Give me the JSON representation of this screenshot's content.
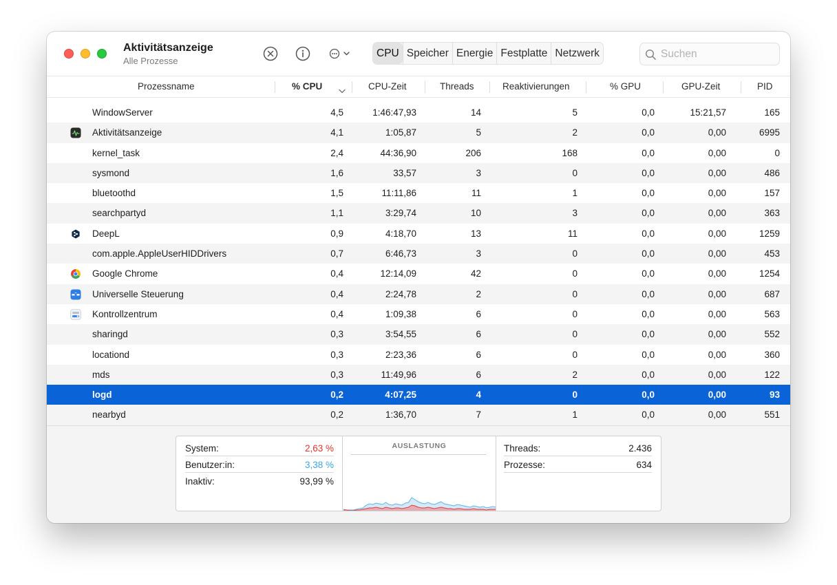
{
  "window": {
    "title": "Aktivitätsanzeige",
    "subtitle": "Alle Prozesse"
  },
  "toolbar": {
    "stop_icon": "stop-process-icon",
    "info_icon": "info-icon",
    "more_icon": "more-actions-icon",
    "tabs": [
      {
        "label": "CPU",
        "active": true
      },
      {
        "label": "Speicher",
        "active": false
      },
      {
        "label": "Energie",
        "active": false
      },
      {
        "label": "Festplatte",
        "active": false
      },
      {
        "label": "Netzwerk",
        "active": false
      }
    ],
    "search": {
      "placeholder": "Suchen",
      "value": ""
    }
  },
  "table": {
    "columns": [
      "Prozessname",
      "% CPU",
      "CPU-Zeit",
      "Threads",
      "Reaktivierungen",
      "% GPU",
      "GPU-Zeit",
      "PID"
    ],
    "sorted_column": "% CPU",
    "rows": [
      {
        "name": "WindowServer",
        "cpu": "4,5",
        "cpu_time": "1:46:47,93",
        "threads": "14",
        "wakeups": "5",
        "gpu": "0,0",
        "gpu_time": "15:21,57",
        "pid": "165",
        "icon": ""
      },
      {
        "name": "Aktivitätsanzeige",
        "cpu": "4,1",
        "cpu_time": "1:05,87",
        "threads": "5",
        "wakeups": "2",
        "gpu": "0,0",
        "gpu_time": "0,00",
        "pid": "6995",
        "icon": "activity-monitor-app-icon"
      },
      {
        "name": "kernel_task",
        "cpu": "2,4",
        "cpu_time": "44:36,90",
        "threads": "206",
        "wakeups": "168",
        "gpu": "0,0",
        "gpu_time": "0,00",
        "pid": "0",
        "icon": ""
      },
      {
        "name": "sysmond",
        "cpu": "1,6",
        "cpu_time": "33,57",
        "threads": "3",
        "wakeups": "0",
        "gpu": "0,0",
        "gpu_time": "0,00",
        "pid": "486",
        "icon": ""
      },
      {
        "name": "bluetoothd",
        "cpu": "1,5",
        "cpu_time": "11:11,86",
        "threads": "11",
        "wakeups": "1",
        "gpu": "0,0",
        "gpu_time": "0,00",
        "pid": "157",
        "icon": ""
      },
      {
        "name": "searchpartyd",
        "cpu": "1,1",
        "cpu_time": "3:29,74",
        "threads": "10",
        "wakeups": "3",
        "gpu": "0,0",
        "gpu_time": "0,00",
        "pid": "363",
        "icon": ""
      },
      {
        "name": "DeepL",
        "cpu": "0,9",
        "cpu_time": "4:18,70",
        "threads": "13",
        "wakeups": "11",
        "gpu": "0,0",
        "gpu_time": "0,00",
        "pid": "1259",
        "icon": "deepl-app-icon"
      },
      {
        "name": "com.apple.AppleUserHIDDrivers",
        "cpu": "0,7",
        "cpu_time": "6:46,73",
        "threads": "3",
        "wakeups": "0",
        "gpu": "0,0",
        "gpu_time": "0,00",
        "pid": "453",
        "icon": ""
      },
      {
        "name": "Google Chrome",
        "cpu": "0,4",
        "cpu_time": "12:14,09",
        "threads": "42",
        "wakeups": "0",
        "gpu": "0,0",
        "gpu_time": "0,00",
        "pid": "1254",
        "icon": "chrome-app-icon"
      },
      {
        "name": "Universelle Steuerung",
        "cpu": "0,4",
        "cpu_time": "2:24,78",
        "threads": "2",
        "wakeups": "0",
        "gpu": "0,0",
        "gpu_time": "0,00",
        "pid": "687",
        "icon": "universal-control-app-icon"
      },
      {
        "name": "Kontrollzentrum",
        "cpu": "0,4",
        "cpu_time": "1:09,38",
        "threads": "6",
        "wakeups": "0",
        "gpu": "0,0",
        "gpu_time": "0,00",
        "pid": "563",
        "icon": "control-center-app-icon"
      },
      {
        "name": "sharingd",
        "cpu": "0,3",
        "cpu_time": "3:54,55",
        "threads": "6",
        "wakeups": "0",
        "gpu": "0,0",
        "gpu_time": "0,00",
        "pid": "552",
        "icon": ""
      },
      {
        "name": "locationd",
        "cpu": "0,3",
        "cpu_time": "2:23,36",
        "threads": "6",
        "wakeups": "0",
        "gpu": "0,0",
        "gpu_time": "0,00",
        "pid": "360",
        "icon": ""
      },
      {
        "name": "mds",
        "cpu": "0,3",
        "cpu_time": "11:49,96",
        "threads": "6",
        "wakeups": "2",
        "gpu": "0,0",
        "gpu_time": "0,00",
        "pid": "122",
        "icon": ""
      },
      {
        "name": "logd",
        "cpu": "0,2",
        "cpu_time": "4:07,25",
        "threads": "4",
        "wakeups": "0",
        "gpu": "0,0",
        "gpu_time": "0,00",
        "pid": "93",
        "icon": "",
        "selected": true
      },
      {
        "name": "nearbyd",
        "cpu": "0,2",
        "cpu_time": "1:36,70",
        "threads": "7",
        "wakeups": "1",
        "gpu": "0,0",
        "gpu_time": "0,00",
        "pid": "551",
        "icon": ""
      }
    ]
  },
  "stats": {
    "system": {
      "label": "System:",
      "value": "2,63 %",
      "color": "#e5322d"
    },
    "user": {
      "label": "Benutzer:in:",
      "value": "3,38 %",
      "color": "#3ba6e6"
    },
    "idle": {
      "label": "Inaktiv:",
      "value": "93,99 %"
    },
    "graph_title": "AUSLASTUNG",
    "threads": {
      "label": "Threads:",
      "value": "2.436"
    },
    "processes": {
      "label": "Prozesse:",
      "value": "634"
    }
  },
  "load_history": {
    "user_color": "#9fd0f2",
    "system_color": "#f27a7a",
    "user": [
      2,
      1,
      1,
      1,
      2,
      3,
      4,
      8,
      10,
      9,
      11,
      10,
      9,
      12,
      9,
      8,
      10,
      9,
      8,
      11,
      12,
      19,
      16,
      13,
      11,
      10,
      12,
      10,
      9,
      11,
      13,
      10,
      9,
      8,
      7,
      9,
      8,
      7,
      6,
      5,
      7,
      6,
      5,
      6,
      4,
      5,
      6,
      5
    ],
    "system": [
      1,
      1,
      0,
      0,
      1,
      1,
      2,
      3,
      4,
      4,
      5,
      4,
      3,
      5,
      4,
      3,
      4,
      4,
      3,
      4,
      5,
      8,
      7,
      5,
      4,
      4,
      5,
      4,
      3,
      4,
      5,
      4,
      3,
      3,
      2,
      3,
      3,
      2,
      2,
      2,
      3,
      2,
      2,
      2,
      1,
      2,
      2,
      2
    ]
  }
}
